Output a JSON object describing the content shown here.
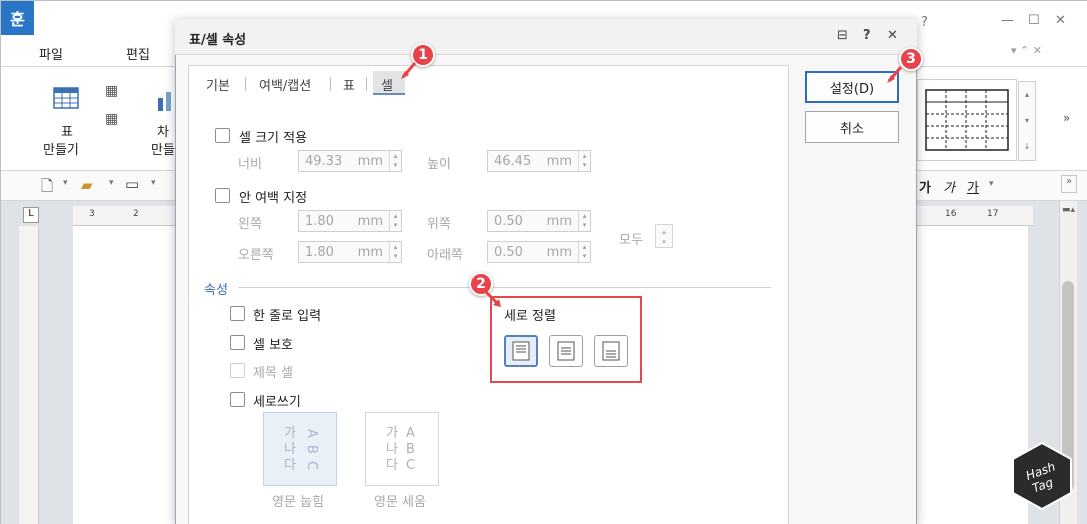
{
  "app": {
    "logo_char": "훈",
    "menu": [
      "파일",
      "편집"
    ],
    "window_controls": [
      "?",
      "—",
      "☐",
      "✕"
    ],
    "ribbon": {
      "table_button_label_1": "표",
      "table_button_label_2": "만들기",
      "chart_label_1": "차",
      "chart_label_2": "만들"
    },
    "format_buttons": [
      "가",
      "가",
      "가"
    ],
    "ruler_marks": [
      "3",
      "2",
      "16",
      "17"
    ]
  },
  "dialog": {
    "title": "표/셀 속성",
    "title_icons": [
      "⊟",
      "?",
      "✕"
    ],
    "tabs": [
      "기본",
      "여백/캡션",
      "표",
      "셀"
    ],
    "active_tab": "셀",
    "cell_size": {
      "checkbox_label": "셀 크기 적용",
      "width_label": "너비",
      "width_value": "49.33",
      "height_label": "높이",
      "height_value": "46.45",
      "unit": "mm"
    },
    "inner_margin": {
      "checkbox_label": "안 여백 지정",
      "left_label": "왼쪽",
      "left_value": "1.80",
      "top_label": "위쪽",
      "top_value": "0.50",
      "right_label": "오른쪽",
      "right_value": "1.80",
      "bottom_label": "아래쪽",
      "bottom_value": "0.50",
      "all_label": "모두",
      "unit": "mm"
    },
    "properties": {
      "section_label": "속성",
      "single_line": "한 줄로 입력",
      "cell_protect": "셀 보호",
      "title_cell": "제목 셀",
      "vertical_writing": "세로쓰기",
      "vertical_align_label": "세로 정렬",
      "dir_rotate_label": "영문 눕힘",
      "dir_rotate_text": "가 A\n나 B\n다 C",
      "dir_stand_label": "영문 세움",
      "dir_stand_text": "가 A\n나 B\n다 C"
    },
    "buttons": {
      "ok": "설정(D)",
      "cancel": "취소"
    }
  },
  "annotations": {
    "badge_1": "1",
    "badge_2": "2",
    "badge_3": "3"
  },
  "colors": {
    "accent_blue": "#2d6cc0",
    "highlight_red": "#e24a4f",
    "app_logo_blue": "#2a76c6"
  }
}
